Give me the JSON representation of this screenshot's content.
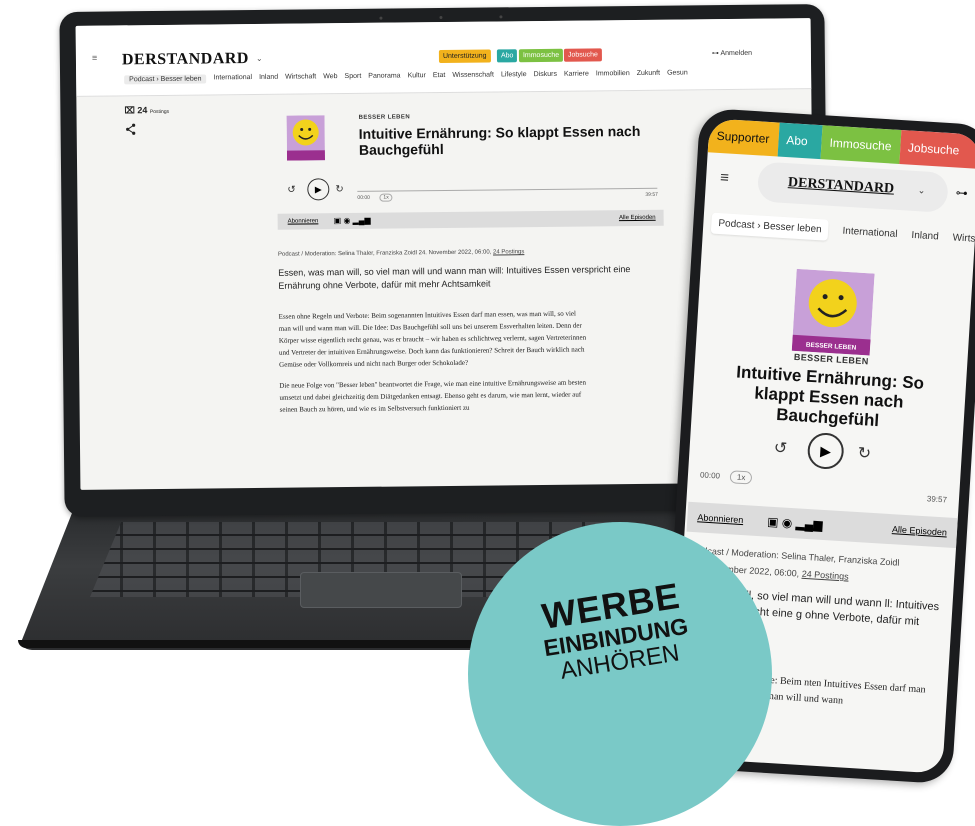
{
  "laptop": {
    "logo": "DERSTANDARD",
    "pills": [
      {
        "label": "Unterstützung",
        "color": "#f2b21c"
      },
      {
        "label": "Abo",
        "color": "#2aa8a2"
      },
      {
        "label": "Immosuche",
        "color": "#7cc142"
      },
      {
        "label": "Jobsuche",
        "color": "#e2584e"
      }
    ],
    "login": "Anmelden",
    "nav": [
      "Podcast › Besser leben",
      "International",
      "Inland",
      "Wirtschaft",
      "Web",
      "Sport",
      "Panorama",
      "Kultur",
      "Etat",
      "Wissenschaft",
      "Lifestyle",
      "Diskurs",
      "Karriere",
      "Immobilien",
      "Zukunft",
      "Gesun"
    ],
    "postings": "24",
    "postings_label": "Postings",
    "kicker": "BESSER LEBEN",
    "title": "Intuitive Ernährung: So klappt Essen nach Bauchgefühl",
    "time_start": "00:00",
    "speed": "1x",
    "time_end": "39:57",
    "subscribe": "Abonnieren",
    "all_episodes": "Alle Episoden",
    "meta": "Podcast / Moderation: Selina Thaler, Franziska Zoidl 24. November 2022, 06:00,",
    "meta_link": "24 Postings",
    "lead": "Essen, was man will, so viel man will und wann man will: Intuitives Essen verspricht eine Ernährung ohne Verbote, dafür mit mehr Achtsamkeit",
    "body1": "Essen ohne Regeln und Verbote: Beim sogenannten Intuitives Essen darf man essen, was man will, so viel man will und wann man will. Die Idee: Das Bauchgefühl soll uns bei unserem Essverhalten leiten. Denn der Körper wisse eigentlich recht genau, was er braucht – wir haben es schlichtweg verlernt, sagen Vertreterinnen und Vertreter der intuitiven Ernährungsweise. Doch kann das funktionieren? Schreit der Bauch wirklich nach Gemüse oder Vollkornreis und nicht nach Burger oder Schokolade?",
    "body2": "Die neue Folge von \"Besser leben\" beantwortet die Frage, wie man eine intuitive Ernährungsweise am besten umsetzt und dabei gleichzeitig dem Diätgedanken entsagt. Ebenso geht es darum, wie man lernt, wieder auf seinen Bauch zu hören, und wie es im Selbstversuch funktioniert zu"
  },
  "phone": {
    "top": [
      {
        "label": "Supporter",
        "color": "#f2b21c",
        "text": "#111111"
      },
      {
        "label": "Abo",
        "color": "#2aa8a2",
        "text": "#ffffff"
      },
      {
        "label": "Immosuche",
        "color": "#7cc142",
        "text": "#ffffff"
      },
      {
        "label": "Jobsuche",
        "color": "#e2584e",
        "text": "#ffffff"
      }
    ],
    "logo": "DERSTANDARD",
    "nav": [
      "Podcast › Besser leben",
      "International",
      "Inland",
      "Wirts"
    ],
    "kicker": "BESSER LEBEN",
    "cover_label": "BESSER LEBEN",
    "title": "Intuitive Ernährung: So klappt Essen nach Bauchgefühl",
    "time_start": "00:00",
    "speed": "1x",
    "time_end": "39:57",
    "subscribe": "Abonnieren",
    "all_episodes": "Alle Episoden",
    "meta": "Podcast / Moderation: Selina Thaler, Franziska Zoidl",
    "date": "24. November 2022, 06:00,",
    "meta_link": "24 Postings",
    "lead": "was man will, so viel man will und wann ll: Intuitives Essen verspricht eine g ohne Verbote, dafür mit mehr keit",
    "body": "ne Regeln und Verbote: Beim nten Intuitives Essen darf man essen, n will, so viel man will und wann"
  },
  "badge": {
    "line1": "WERBE",
    "line2": "EINBINDUNG",
    "line3": "ANHÖREN",
    "color": "#7ac9c7"
  }
}
